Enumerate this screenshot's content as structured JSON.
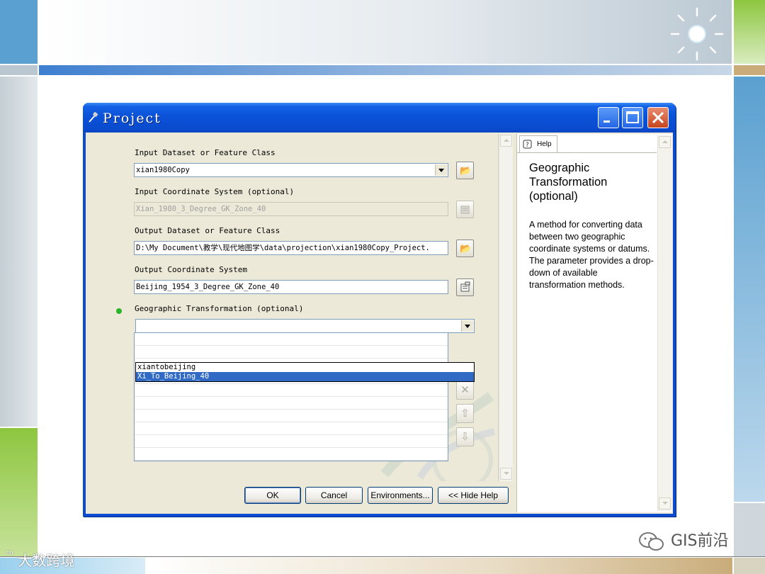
{
  "window": {
    "title": "Project"
  },
  "form": {
    "input_dataset_label": "Input Dataset or Feature Class",
    "input_dataset_value": "xian1980Copy",
    "input_cs_label": "Input Coordinate System (optional)",
    "input_cs_value": "Xian_1980_3_Degree_GK_Zone_40",
    "output_dataset_label": "Output Dataset or Feature Class",
    "output_dataset_value": "D:\\My Document\\教学\\现代地图学\\data\\projection\\xian1980Copy_Project.",
    "output_cs_label": "Output Coordinate System",
    "output_cs_value": "Beijing_1954_3_Degree_GK_Zone_40",
    "geo_transform_label": "Geographic Transformation (optional)",
    "geo_transform_value": "",
    "geo_transform_options": [
      "xiantobeijing",
      "Xi_To_Beijing_40"
    ],
    "geo_transform_selected_index": 1
  },
  "buttons": {
    "ok": "OK",
    "cancel": "Cancel",
    "environments": "Environments...",
    "hide_help": "<< Hide Help"
  },
  "help": {
    "tab_label": "Help",
    "title": "Geographic Transformation (optional)",
    "body": "A method for converting data between two geographic coordinate systems or datums. The parameter provides a drop-down of available transformation methods."
  },
  "watermarks": {
    "bottom_left": "大数跨境",
    "bottom_right": "GIS前沿"
  },
  "colors": {
    "title_bar": "#0a4bcf",
    "selection": "#316ac5",
    "dialog_face": "#ece9d8",
    "close_button": "#c7451f",
    "required_dot": "#2bb52b"
  },
  "icons": {
    "browse": "folder-open-icon",
    "properties": "properties-icon",
    "remove": "x-icon",
    "move_up": "arrow-up-icon",
    "move_down": "arrow-down-icon"
  }
}
